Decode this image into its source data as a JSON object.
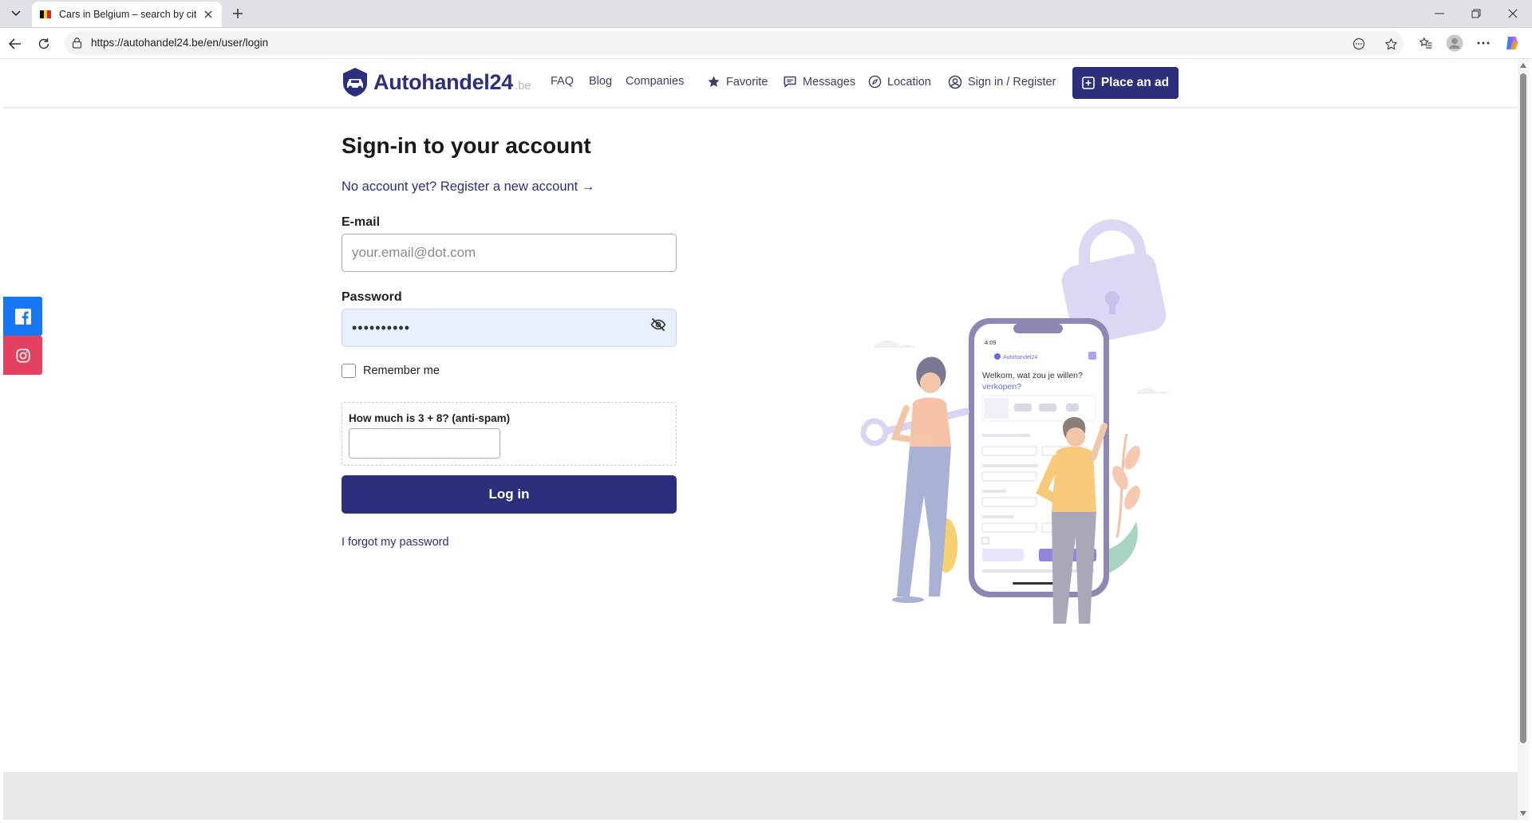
{
  "browser": {
    "tab_title": "Cars in Belgium – search by city, b",
    "url": "https://autohandel24.be/en/user/login"
  },
  "header": {
    "logo_text": "Autohandel24",
    "logo_tld": ".be",
    "nav": {
      "faq": "FAQ",
      "blog": "Blog",
      "companies": "Companies",
      "favorite": "Favorite",
      "messages": "Messages",
      "location": "Location",
      "signin": "Sign in / Register"
    },
    "place_ad": "Place an ad"
  },
  "login": {
    "title": "Sign-in to your account",
    "register_link": "No account yet? Register a new account →",
    "email_label": "E-mail",
    "email_placeholder": "your.email@dot.com",
    "email_value": "",
    "password_label": "Password",
    "password_value": "••••••••••",
    "remember_label": "Remember me",
    "spam_label": "How much is 3 + 8? (anti-spam)",
    "login_button": "Log in",
    "forgot_link": "I forgot my password"
  },
  "illustration": {
    "phone_time": "4:09",
    "phone_brand": "Autohandel24",
    "phone_heading_1": "Welkom, wat zou je willen?",
    "phone_heading_2": "verkopen?"
  },
  "colors": {
    "brand": "#2b2f7c",
    "facebook": "#1877f2",
    "instagram": "#e4405f",
    "autofill": "#e8f0fe"
  }
}
